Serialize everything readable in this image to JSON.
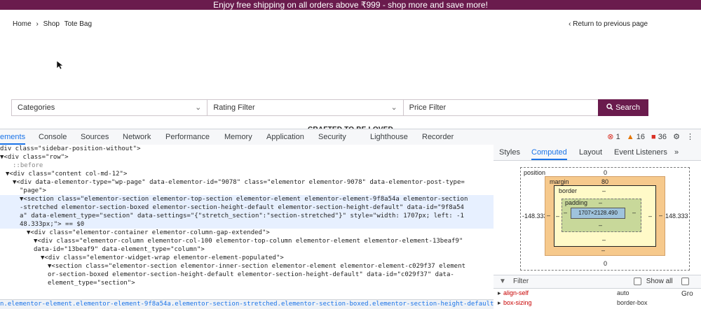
{
  "banner": {
    "text": "Enjoy free shipping on all orders above ₹999 - shop more and save more!"
  },
  "breadcrumb": {
    "home": "Home",
    "separator": "›",
    "shop": "Shop",
    "current": "Tote Bag"
  },
  "return_link": {
    "icon": "‹",
    "text": "Return to previous page"
  },
  "filters": {
    "categories": "Categories",
    "rating": "Rating Filter",
    "price": "Price Filter",
    "search_label": "Search",
    "search_icon": "search-icon"
  },
  "crafted": "CRAFTED TO BE LOVED",
  "devtools": {
    "tabs": [
      "ements",
      "Console",
      "Sources",
      "Network",
      "Performance",
      "Memory",
      "Application",
      "Security",
      "Lighthouse",
      "Recorder"
    ],
    "counts": {
      "errors": "1",
      "warnings": "16",
      "info": "36"
    },
    "elements_lines": [
      "div class=\"sidebar-position-without\">",
      "▼<div class=\"row\">",
      "::before",
      "▼<div class=\"content col-md-12\">",
      "▼<div data-elementor-type=\"wp-page\" data-elementor-id=\"9078\" class=\"elementor elementor-9078\" data-elementor-post-type=",
      "\"page\">",
      "▼<section class=\"elementor-section elementor-top-section elementor-element elementor-element-9f8a54a elementor-section",
      "-stretched elementor-section-boxed elementor-section-height-default elementor-section-height-default\" data-id=\"9f8a54",
      "a\" data-element_type=\"section\" data-settings=\"{\"stretch_section\":\"section-stretched\"}\" style=\"width: 1707px; left: -1",
      "48.333px;\"> == $0",
      "▼<div class=\"elementor-container elementor-column-gap-extended\">",
      "▼<div class=\"elementor-column elementor-col-100 elementor-top-column elementor-element elementor-element-13beaf9\"",
      "data-id=\"13beaf9\" data-element_type=\"column\">",
      "▼<div class=\"elementor-widget-wrap elementor-element-populated\">",
      "▼<section class=\"elementor-section elementor-inner-section elementor-element elementor-element-c029f37 element",
      "or-section-boxed elementor-section-height-default elementor-section-height-default\" data-id=\"c029f37\" data-",
      "element_type=\"section\">"
    ],
    "bottom_breadcrumb": "n.elementor-element.elementor-element-9f8a54a.elementor-section-stretched.elementor-section-boxed.elementor-section-height-default",
    "right_tabs": [
      "Styles",
      "Computed",
      "Layout",
      "Event Listeners",
      "»"
    ],
    "boxmodel": {
      "position_label": "position",
      "position_top": "0",
      "position_bottom": "0",
      "left_value": "-148.333",
      "right_value": "148.333",
      "margin_label": "margin",
      "margin_top": "80",
      "margin_side": "–",
      "margin_bottom": "–",
      "border_label": "border",
      "border_value": "–",
      "padding_label": "padding",
      "padding_value": "–",
      "content_size": "1707×2128.490"
    },
    "filter": {
      "placeholder": "Filter",
      "show_all": "Show all",
      "group": "Gro"
    },
    "properties": [
      {
        "name": "align-self",
        "value": "auto"
      },
      {
        "name": "box-sizing",
        "value": "border-box"
      }
    ]
  }
}
